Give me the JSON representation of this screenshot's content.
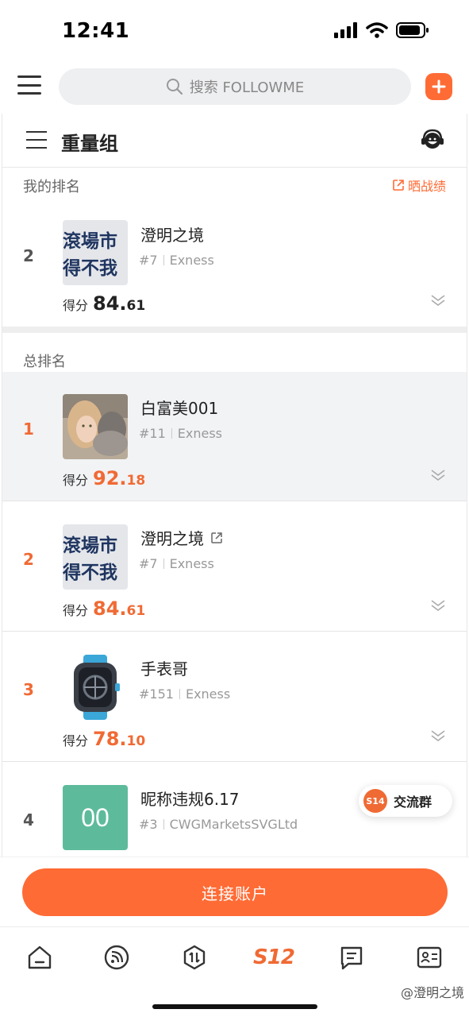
{
  "status": {
    "time": "12:41"
  },
  "search": {
    "text": "搜索 FOLLOWME"
  },
  "group": {
    "title": "重量组"
  },
  "my_rank": {
    "label": "我的排名",
    "share_label": "晒战绩",
    "entry": {
      "rank": "2",
      "name": "澄明之境",
      "id": "#7",
      "broker": "Exness",
      "score_label": "得分",
      "score_int": "84.",
      "score_dec": "61"
    }
  },
  "overall": {
    "label": "总排名",
    "entries": [
      {
        "rank": "1",
        "name": "白富美001",
        "id": "#11",
        "broker": "Exness",
        "score_label": "得分",
        "score_int": "92.",
        "score_dec": "18"
      },
      {
        "rank": "2",
        "name": "澄明之境",
        "id": "#7",
        "broker": "Exness",
        "score_label": "得分",
        "score_int": "84.",
        "score_dec": "61"
      },
      {
        "rank": "3",
        "name": "手表哥",
        "id": "#151",
        "broker": "Exness",
        "score_label": "得分",
        "score_int": "78.",
        "score_dec": "10"
      },
      {
        "rank": "4",
        "name": "昵称违规6.17",
        "id": "#3",
        "broker": "CWGMarketsSVGLtd",
        "avatar_text": "00"
      }
    ]
  },
  "avatar_sign": {
    "line1": "滾場市",
    "line2": "得不我"
  },
  "chat": {
    "badge": "S14",
    "label": "交流群"
  },
  "cta": {
    "label": "连接账户"
  },
  "tabs": {
    "s12_label": "S12"
  },
  "watermark": "@澄明之境",
  "colors": {
    "accent": "#ff6b35",
    "rank_orange": "#f06a34",
    "avatar_teal": "#5dbb9b"
  }
}
